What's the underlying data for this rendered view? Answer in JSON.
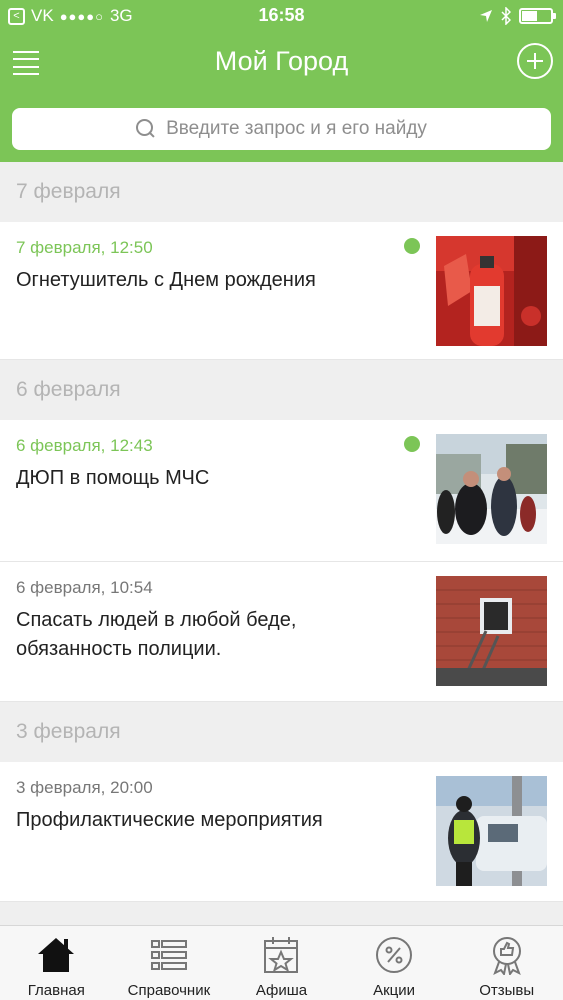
{
  "status_bar": {
    "carrier": "VK",
    "signal": "●●●●○",
    "network": "3G",
    "time": "16:58",
    "battery_level": 0.55
  },
  "header": {
    "title": "Мой Город",
    "menu_icon": "hamburger-icon",
    "add_icon": "plus-circle-icon"
  },
  "search": {
    "placeholder": "Введите запрос и я его найду"
  },
  "colors": {
    "accent": "#7cc557",
    "date_header_text": "#b4b4b4"
  },
  "feed": {
    "groups": [
      {
        "date": "7 февраля",
        "items": [
          {
            "meta": "7 февраля, 12:50",
            "title": "Огнетушитель с Днем рождения",
            "unread": true
          }
        ]
      },
      {
        "date": "6 февраля",
        "items": [
          {
            "meta": "6 февраля, 12:43",
            "title": "ДЮП в помощь МЧС",
            "unread": true
          },
          {
            "meta": "6 февраля, 10:54",
            "title": "Спасать людей в любой беде, обязанность полиции.",
            "unread": false
          }
        ]
      },
      {
        "date": "3 февраля",
        "items": [
          {
            "meta": "3 февраля, 20:00",
            "title": "Профилактические мероприятия",
            "unread": false
          }
        ]
      }
    ]
  },
  "tabbar": {
    "tabs": [
      {
        "label": "Главная",
        "icon": "house-icon",
        "active": true
      },
      {
        "label": "Справочник",
        "icon": "list-icon",
        "active": false
      },
      {
        "label": "Афиша",
        "icon": "calendar-star-icon",
        "active": false
      },
      {
        "label": "Акции",
        "icon": "percent-icon",
        "active": false
      },
      {
        "label": "Отзывы",
        "icon": "thumbs-up-badge-icon",
        "active": false
      }
    ]
  }
}
